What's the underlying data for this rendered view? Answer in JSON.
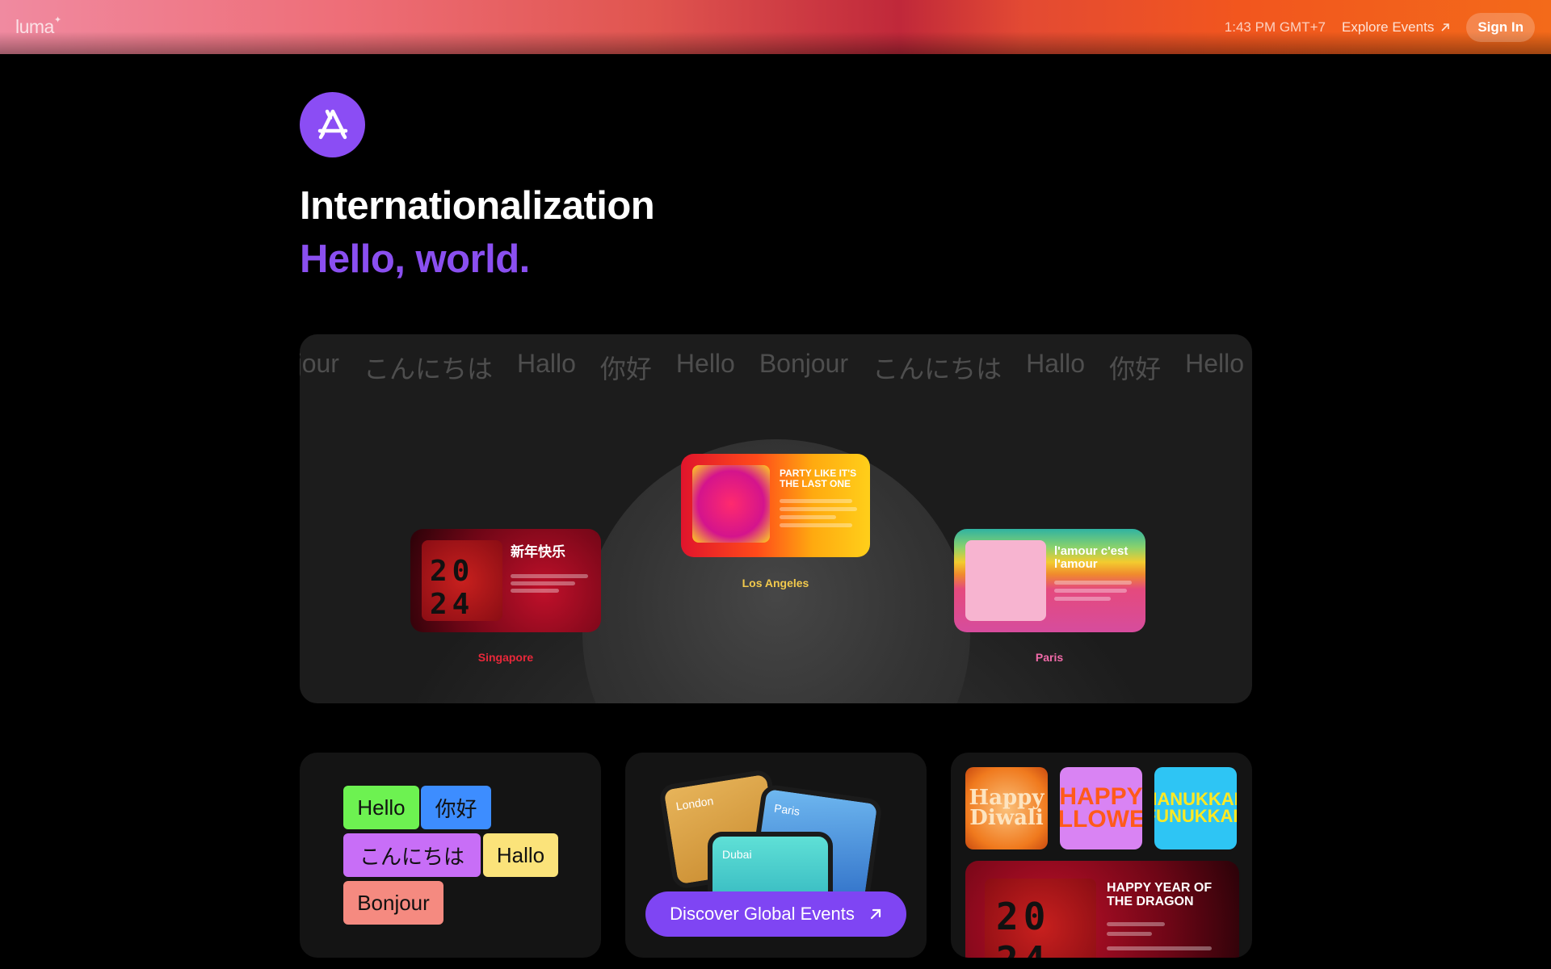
{
  "header": {
    "logo": "luma",
    "time": "1:43 PM GMT+7",
    "explore_label": "Explore Events",
    "signin_label": "Sign In"
  },
  "hero": {
    "title": "Internationalization",
    "subtitle": "Hello, world."
  },
  "map": {
    "greetings": [
      "onjour",
      "こんにちは",
      "Hallo",
      "你好",
      "Hello",
      "Bonjour",
      "こんにちは",
      "Hallo",
      "你好",
      "Hello"
    ],
    "cities": [
      {
        "name": "Singapore",
        "event_title": "新年快乐",
        "color": "#e8283a"
      },
      {
        "name": "Los Angeles",
        "event_title": "PARTY LIKE IT'S THE LAST ONE",
        "color": "#f2c94c"
      },
      {
        "name": "Paris",
        "event_title": "l'amour c'est l'amour",
        "color": "#f06aa8"
      }
    ]
  },
  "tiles": {
    "greetings": {
      "hello": "Hello",
      "nihao": "你好",
      "konnichiwa": "こんにちは",
      "hallo": "Hallo",
      "bonjour": "Bonjour"
    },
    "global": {
      "london": "London",
      "paris": "Paris",
      "dubai": "Dubai",
      "button_label": "Discover Global Events"
    },
    "holidays": {
      "diwali": "Happy Diwali",
      "halloween": "HAPPY HALLOWEEN",
      "hanukkah": "HANUKKAH FUNUKKAH",
      "year_of_dragon": "HAPPY YEAR OF THE DRAGON"
    }
  },
  "colors": {
    "accent": "#8a4ff0",
    "button": "#7f45f3"
  }
}
